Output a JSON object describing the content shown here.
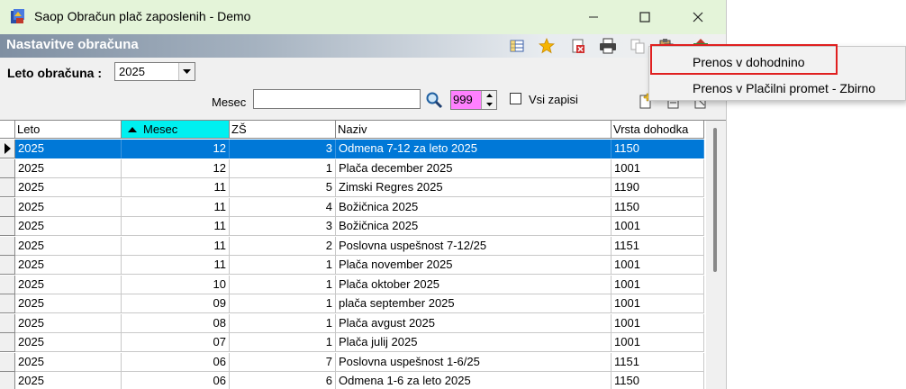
{
  "window": {
    "title": "Saop Obračun plač zaposlenih - Demo"
  },
  "panel": {
    "title": "Nastavitve obračuna"
  },
  "filters": {
    "leto_label": "Leto obračuna :",
    "leto_value": "2025",
    "mesec_label": "Mesec",
    "mesec_value": "",
    "count_value": "999",
    "vsi_zapisi_label": "Vsi zapisi"
  },
  "table": {
    "columns": [
      "Leto",
      "Mesec",
      "ZŠ",
      "Naziv",
      "Vrsta dohodka"
    ],
    "sorted_column": "Mesec",
    "rows": [
      [
        "2025",
        "12",
        "3",
        "Odmena 7-12 za leto 2025",
        "1150"
      ],
      [
        "2025",
        "12",
        "1",
        "Plača december 2025",
        "1001"
      ],
      [
        "2025",
        "11",
        "5",
        "Zimski Regres 2025",
        "1190"
      ],
      [
        "2025",
        "11",
        "4",
        "Božičnica 2025",
        "1150"
      ],
      [
        "2025",
        "11",
        "3",
        "Božičnica 2025",
        "1001"
      ],
      [
        "2025",
        "11",
        "2",
        "Poslovna uspešnost 7-12/25",
        "1151"
      ],
      [
        "2025",
        "11",
        "1",
        "Plača november 2025",
        "1001"
      ],
      [
        "2025",
        "10",
        "1",
        "Plača oktober 2025",
        "1001"
      ],
      [
        "2025",
        "09",
        "1",
        "plača september 2025",
        "1001"
      ],
      [
        "2025",
        "08",
        "1",
        "Plača avgust 2025",
        "1001"
      ],
      [
        "2025",
        "07",
        "1",
        "Plača julij 2025",
        "1001"
      ],
      [
        "2025",
        "06",
        "7",
        "Poslovna uspešnost 1-6/25",
        "1151"
      ],
      [
        "2025",
        "06",
        "6",
        "Odmena 1-6 za leto 2025",
        "1150"
      ]
    ]
  },
  "context_menu": {
    "items": [
      "Prenos v dohodnino",
      "Prenos v Plačilni promet - Zbirno"
    ],
    "highlighted": "Prenos v dohodnino"
  },
  "colors": {
    "titlebar": "#e4f4d9",
    "selection": "#0078d7",
    "sorted_header": "#00f0f0",
    "count_field": "#ff80ff",
    "highlight_box": "#e02020"
  }
}
